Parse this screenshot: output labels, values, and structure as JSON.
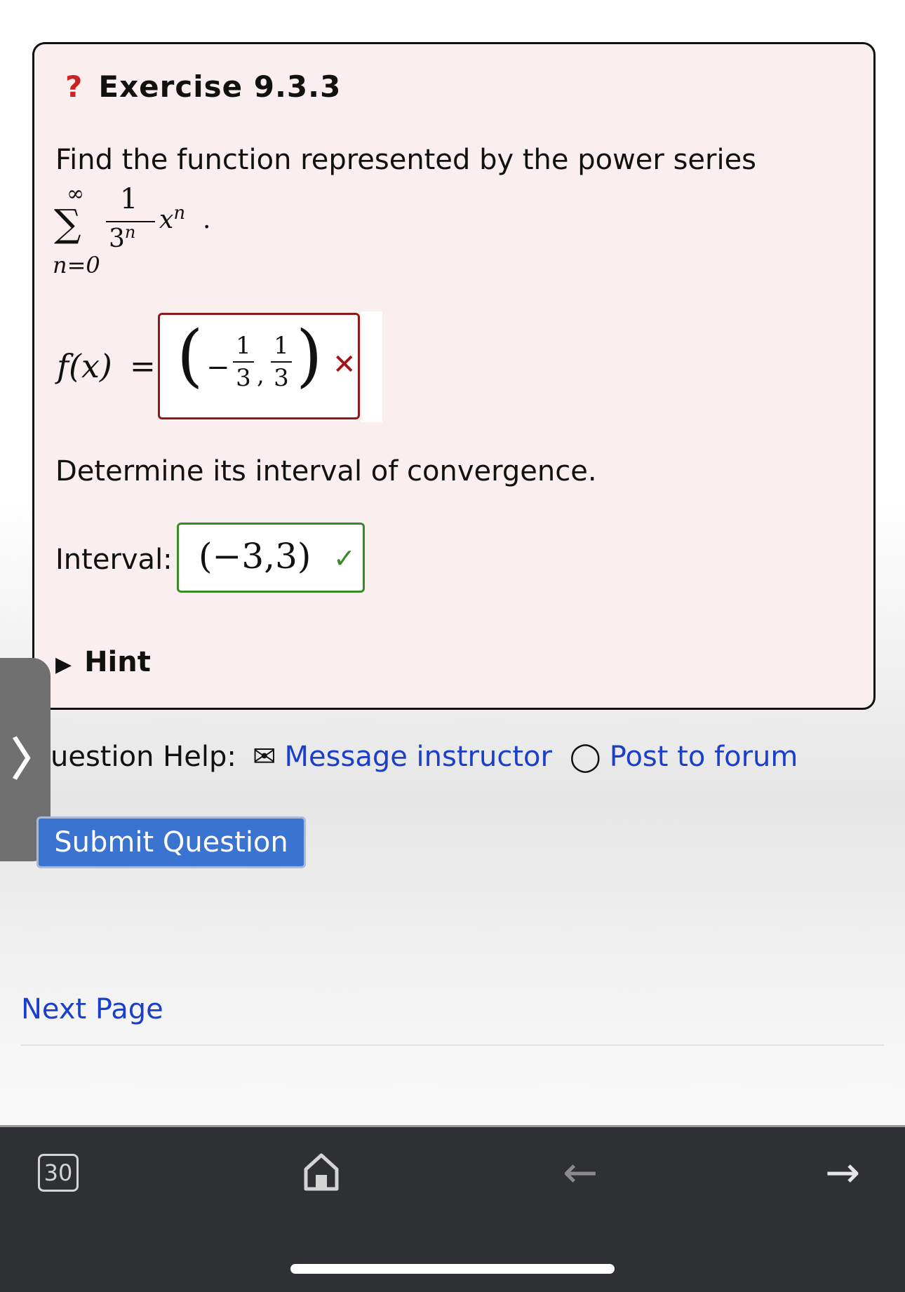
{
  "exercise": {
    "icon_text": "?",
    "title": "Exercise 9.3.3",
    "prompt": "Find the function represented by the power series",
    "series": {
      "sigma": "∑",
      "upper": "∞",
      "lower": "n=0",
      "numerator": "1",
      "denominator_base": "3",
      "denominator_exp": "n",
      "term": "x",
      "term_exp": "n",
      "period": "."
    },
    "function_label": "f(x)",
    "equals": "=",
    "function_answer": {
      "open": "(",
      "minus": "−",
      "num1": "1",
      "den1": "3",
      "comma": ",",
      "num2": "1",
      "den2": "3",
      "close": ")",
      "status": "incorrect",
      "status_mark": "✕"
    },
    "prompt2": "Determine its interval of convergence.",
    "interval_label": "Interval:",
    "interval_answer": {
      "value": "(−3,3)",
      "status": "correct",
      "status_mark": "✓"
    },
    "hint_label": "Hint",
    "hint_icon": "▶"
  },
  "side_tab": {
    "icon": "〉"
  },
  "help": {
    "label": "uestion Help:",
    "message_icon": "✉",
    "message_link": "Message instructor",
    "forum_icon": "◯",
    "forum_link": "Post to forum"
  },
  "submit_button": "Submit Question",
  "next_page": "Next Page",
  "browser_bar": {
    "tab_count": "30",
    "home_icon": "home-icon",
    "back_icon": "←",
    "forward_icon": "→"
  },
  "colors": {
    "card_bg": "#fbeeee",
    "incorrect": "#8b1a1a",
    "correct": "#3a8a2a",
    "link": "#1a3fcc",
    "button": "#3b73d1"
  }
}
